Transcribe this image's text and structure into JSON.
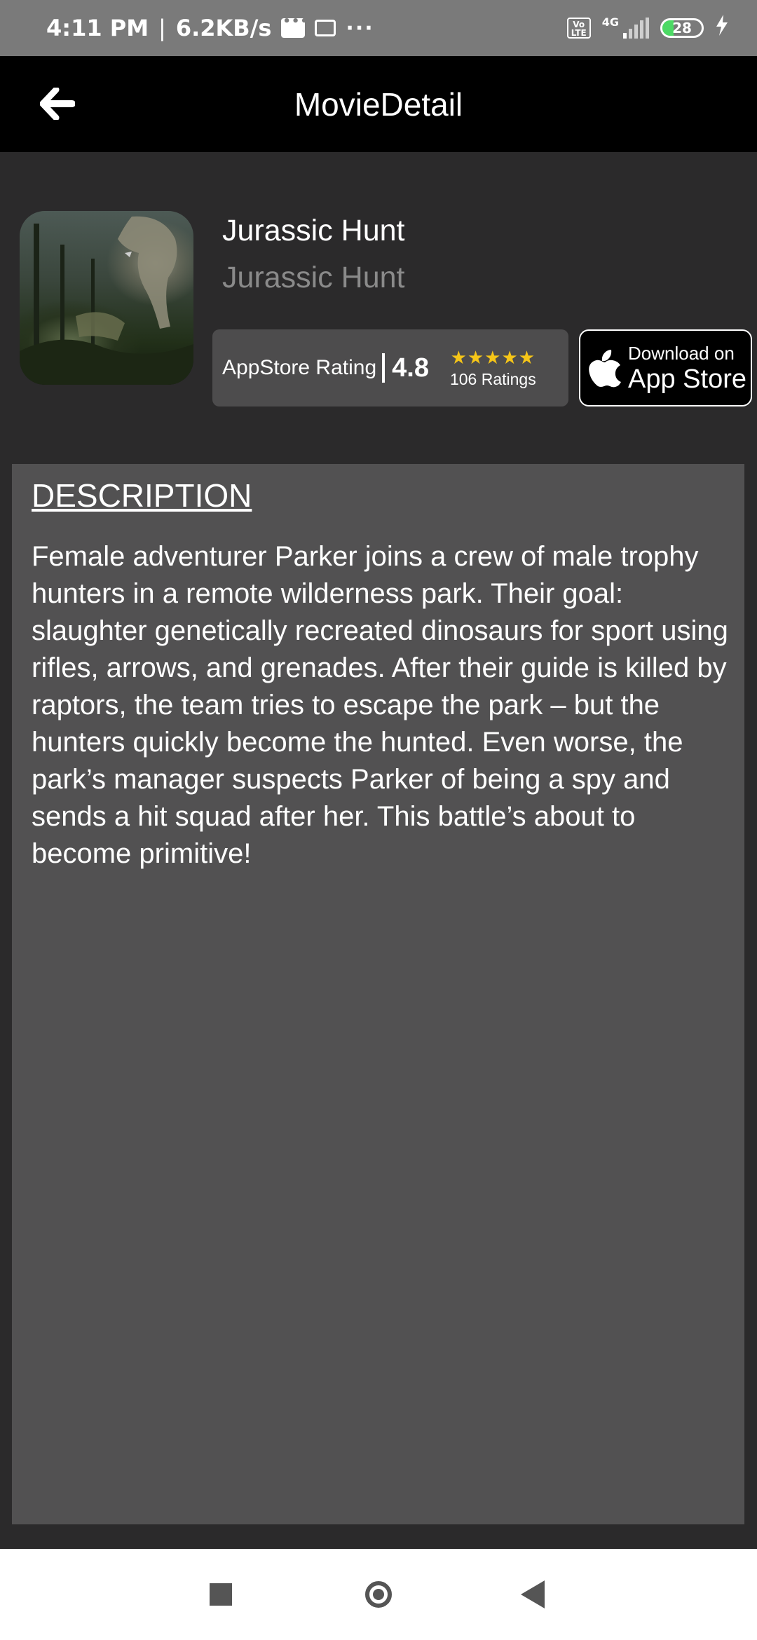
{
  "status_bar": {
    "time": "4:11 PM",
    "separator": "|",
    "speed": "6.2KB/s",
    "dots": "···",
    "volte_label": "Vo LTE",
    "network": "4G",
    "battery": "28",
    "battery_level": 0.28
  },
  "app_bar": {
    "title": "MovieDetail",
    "back_icon": "arrow-left-icon"
  },
  "movie": {
    "title": "Jurassic Hunt",
    "subtitle": "Jurassic Hunt",
    "rating_label": "AppStore Rating",
    "rating_value": "4.8",
    "stars": "★★★★★",
    "star_count": 5,
    "rating_count": "106 Ratings"
  },
  "appstore_button": {
    "small_text": "Download on",
    "big_text": "App Store",
    "icon": "apple-icon"
  },
  "description": {
    "heading": "DESCRIPTION",
    "body": "Female adventurer Parker joins a crew of male trophy hunters in a remote wilderness park. Their goal: slaughter genetically recreated dinosaurs for sport using rifles, arrows, and grenades. After their guide is killed by raptors, the team tries to escape the park – but the hunters quickly become the hunted. Even worse, the park’s manager suspects Parker of being a spy and sends a hit squad after her. This battle’s about to become primitive!"
  },
  "colors": {
    "status_bar_bg": "#7a7a7a",
    "app_bar_bg": "#000000",
    "page_bg": "#2b2a2b",
    "card_bg": "#525152",
    "rating_box_bg": "#4d4c4d",
    "star_color": "#f5c518",
    "subtitle_color": "#8a8a8a"
  },
  "nav": {
    "recents_icon": "square-icon",
    "home_icon": "circle-home-icon",
    "back_icon": "triangle-back-icon"
  }
}
